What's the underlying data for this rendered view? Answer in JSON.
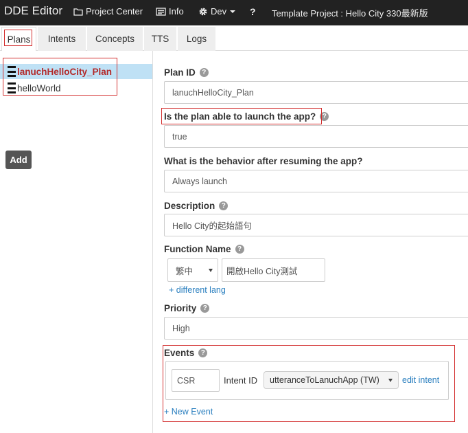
{
  "navbar": {
    "brand": "DDE Editor",
    "project_center": "Project Center",
    "info": "Info",
    "dev": "Dev",
    "help": "?",
    "project_title": "Template Project : Hello City 330最新版"
  },
  "tabs": [
    "Plans",
    "Intents",
    "Concepts",
    "TTS",
    "Logs"
  ],
  "plans": {
    "items": [
      "lanuchHelloCity_Plan",
      "helloWorld"
    ],
    "add_label": "Add"
  },
  "form": {
    "plan_id_label": "Plan ID",
    "plan_id_value": "lanuchHelloCity_Plan",
    "launch_label": "Is the plan able to launch the app?",
    "launch_value": "true",
    "resume_label": "What is the behavior after resuming the app?",
    "resume_value": "Always launch",
    "description_label": "Description",
    "description_value": "Hello City的起始語句",
    "function_name_label": "Function Name",
    "function_lang": "繁中",
    "function_name_value": "開啟Hello City測試",
    "different_lang": "+ different lang",
    "priority_label": "Priority",
    "priority_value": "High",
    "events_label": "Events",
    "event_type": "CSR",
    "intent_id_label": "Intent ID",
    "intent_id_value": "utteranceToLanuchApp (TW)",
    "edit_intent": "edit intent",
    "new_event": "+ New Event"
  },
  "colors": {
    "navbar_bg": "#222222",
    "selected_row_bg": "#bfe1f5",
    "selected_row_text": "#b32a2a",
    "highlight_border": "#d32f2f",
    "link": "#2a7fbf"
  }
}
